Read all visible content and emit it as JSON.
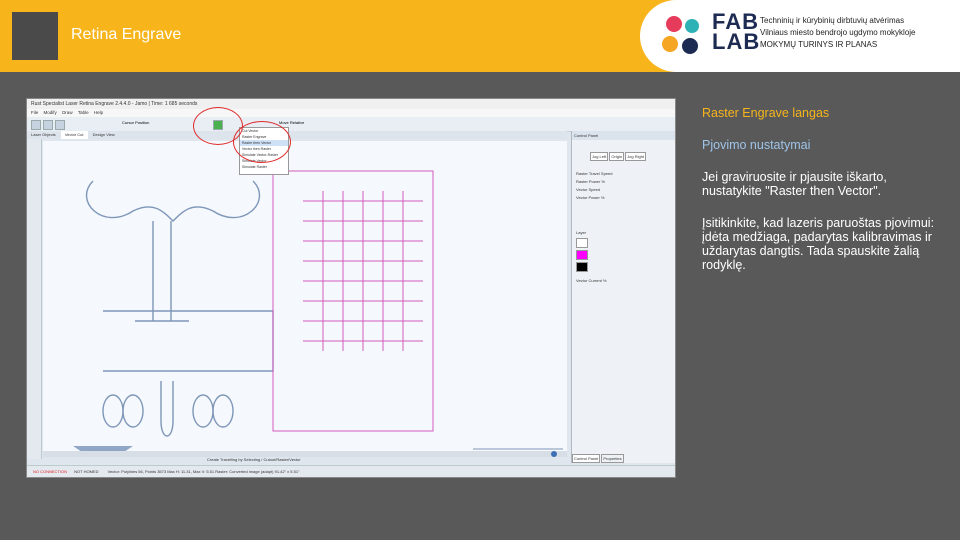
{
  "header": {
    "title": "Retina Engrave",
    "fab_logo_text": [
      "FAB",
      "LAB"
    ],
    "org_lines": [
      "Techninių ir kūrybinių dirbtuvių atvėrimas",
      "Vilniaus miesto bendrojo ugdymo mokykloje",
      "MOKYMŲ TURINYS IR PLANAS"
    ]
  },
  "screenshot": {
    "window_title": "Rust Specialist Laser Retina Engrave 2.4.4.0 - Jamo | Time: 1 685 seconds",
    "menu": [
      "File",
      "Modify",
      "Draw",
      "Table",
      "Help"
    ],
    "toolbar_labels": [
      "Cursor Position",
      "Move Relative"
    ],
    "tabs": [
      "Laser Objects",
      "Vector Cut",
      "Design View"
    ],
    "dropdown_items": [
      "Cut Vector",
      "Raster Engrave",
      "Raster then Vector",
      "Vector then Raster",
      "Simulate Vector-Raster",
      "Simulate Vector",
      "Simulate Raster"
    ],
    "dropdown_selected_index": 2,
    "panel": {
      "title": "Control Panel",
      "buttons": [
        "Jog Left",
        "Origin",
        "Jog Right"
      ],
      "labels": [
        "Raster Travel Speed",
        "Raster Power %",
        "Vector Speed",
        "Vector Power %",
        "Layer",
        "Vector Current %"
      ],
      "layer_colors": [
        "#ffffff",
        "#ff00ff",
        "#000000"
      ]
    },
    "statusbar": {
      "connection": "NO CONNECTION",
      "status": "NOT HOMED",
      "message": "Vector: Polylines 56, Points 3573 Max H: 11.31, Max V: 5.51  Raster: Converted image (adapt) 91.42\" x 5.51\""
    },
    "footer_hint": "Create Travelling by Selecting / Cutout/Raster/Vector",
    "panel_tabs": [
      "Control Panel",
      "Properties"
    ]
  },
  "notes": {
    "raster_heading": "Raster Engrave langas",
    "cut_heading": "Pjovimo nustatymai",
    "para1": "Jei graviruosite ir pjausite iškarto, nustatykite \"Raster then Vector\".",
    "para2": "Įsitikinkite, kad lazeris paruoštas pjovimui: įdėta medžiaga, padarytas kalibravimas ir uždarytas dangtis. Tada spauskite žalią rodyklę."
  }
}
